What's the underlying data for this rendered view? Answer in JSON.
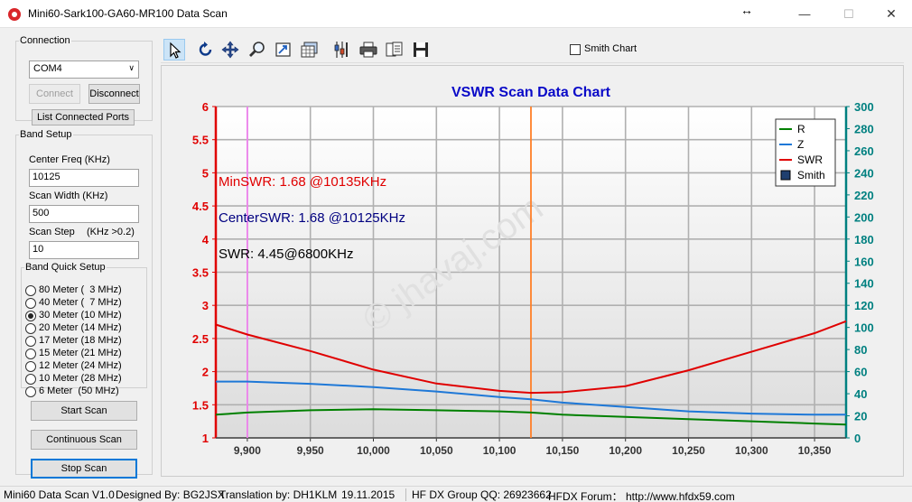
{
  "window": {
    "title": "Mini60-Sark100-GA60-MR100 Data Scan",
    "resize_icon": "↔",
    "minimize_icon": "—",
    "maximize_icon": "☐",
    "close_icon": "✕"
  },
  "connection": {
    "legend": "Connection",
    "port": "COM4",
    "connect_label": "Connect",
    "disconnect_label": "Disconnect",
    "list_ports_label": "List Connected Ports"
  },
  "band_setup": {
    "legend": "Band Setup",
    "center_freq_label": "Center Freq  (KHz)",
    "center_freq_value": "10125",
    "scan_width_label": "Scan Width   (KHz)",
    "scan_width_value": "500",
    "scan_step_label": "Scan Step",
    "scan_step_hint": "(KHz >0.2)",
    "scan_step_value": "10",
    "quick_legend": "Band Quick Setup",
    "bands": [
      {
        "label": "80 Meter (  3 MHz)",
        "selected": false
      },
      {
        "label": "40 Meter (  7 MHz)",
        "selected": false
      },
      {
        "label": "30 Meter (10 MHz)",
        "selected": true
      },
      {
        "label": "20 Meter (14 MHz)",
        "selected": false
      },
      {
        "label": "17 Meter (18 MHz)",
        "selected": false
      },
      {
        "label": "15 Meter (21 MHz)",
        "selected": false
      },
      {
        "label": "12 Meter (24 MHz)",
        "selected": false
      },
      {
        "label": "10 Meter (28 MHz)",
        "selected": false
      },
      {
        "label": "6 Meter  (50 MHz)",
        "selected": false
      }
    ],
    "start_label": "Start Scan",
    "continuous_label": "Continuous Scan",
    "stop_label": "Stop Scan"
  },
  "toolbar": {
    "tools": [
      "pointer-icon",
      "rotate-icon",
      "move-icon",
      "zoom-icon",
      "export-icon",
      "grid-icon",
      "settings-icon",
      "print-icon",
      "copy-icon",
      "save-icon"
    ],
    "smith_chart_label": "Smith Chart",
    "smith_chart_checked": false
  },
  "chart_data": {
    "type": "line",
    "title": "VSWR Scan Data Chart",
    "x": [
      9875,
      9900,
      9950,
      10000,
      10050,
      10100,
      10125,
      10150,
      10200,
      10250,
      10300,
      10350,
      10375
    ],
    "xlim": [
      9875,
      10375
    ],
    "x_ticks": [
      "9,900",
      "9,950",
      "10,000",
      "10,050",
      "10,100",
      "10,150",
      "10,200",
      "10,250",
      "10,300",
      "10,350"
    ],
    "left_axis": {
      "ylim": [
        1,
        6
      ],
      "ticks": [
        "1",
        "1.5",
        "2",
        "2.5",
        "3",
        "3.5",
        "4",
        "4.5",
        "5",
        "5.5",
        "6"
      ],
      "color": "#e00000"
    },
    "right_axis": {
      "ylim": [
        0,
        300
      ],
      "ticks": [
        "0",
        "20",
        "40",
        "60",
        "80",
        "100",
        "120",
        "140",
        "160",
        "180",
        "200",
        "220",
        "240",
        "260",
        "280",
        "300"
      ],
      "color": "#008080"
    },
    "series": [
      {
        "name": "R",
        "axis": "right",
        "color": "#008000",
        "values": [
          21,
          23,
          25,
          26,
          25,
          24,
          23,
          21,
          19,
          17,
          15,
          13,
          12
        ]
      },
      {
        "name": "Z",
        "axis": "right",
        "color": "#1e78d7",
        "values": [
          51,
          51,
          49,
          46,
          42,
          37,
          35,
          32,
          28,
          24,
          22,
          21,
          21
        ]
      },
      {
        "name": "SWR",
        "axis": "left",
        "color": "#e00000",
        "values": [
          2.71,
          2.56,
          2.31,
          2.03,
          1.82,
          1.71,
          1.68,
          1.69,
          1.78,
          2.02,
          2.3,
          2.58,
          2.76
        ]
      }
    ],
    "legend_items": [
      {
        "label": "R",
        "color": "#008000",
        "kind": "line"
      },
      {
        "label": "Z",
        "color": "#1e78d7",
        "kind": "line"
      },
      {
        "label": "SWR",
        "color": "#e00000",
        "kind": "line"
      },
      {
        "label": "Smith",
        "color": "#1f3f6f",
        "kind": "box"
      }
    ],
    "legend_position": "top-right",
    "grid": true,
    "markers": [
      {
        "x": 9900,
        "color": "#ee82ee"
      },
      {
        "x": 10125,
        "color": "#ff7f27"
      }
    ],
    "annotations": [
      {
        "text": "MinSWR: 1.68 @10135KHz",
        "color": "#e00000"
      },
      {
        "text": "CenterSWR: 1.68 @10125KHz",
        "color": "#000080"
      },
      {
        "text": "SWR: 4.45@6800KHz",
        "color": "#000000"
      }
    ],
    "watermark": "© jhavaj.com"
  },
  "status": {
    "version": "Mini60 Data Scan V1.0",
    "designer": "Designed By: BG2JSX",
    "translation": "Translation by: DH1KLM",
    "date": "19.11.2015",
    "group": "HF DX Group QQ: 26923662",
    "forum": "HFDX Forum：  http://www.hfdx59.com"
  }
}
